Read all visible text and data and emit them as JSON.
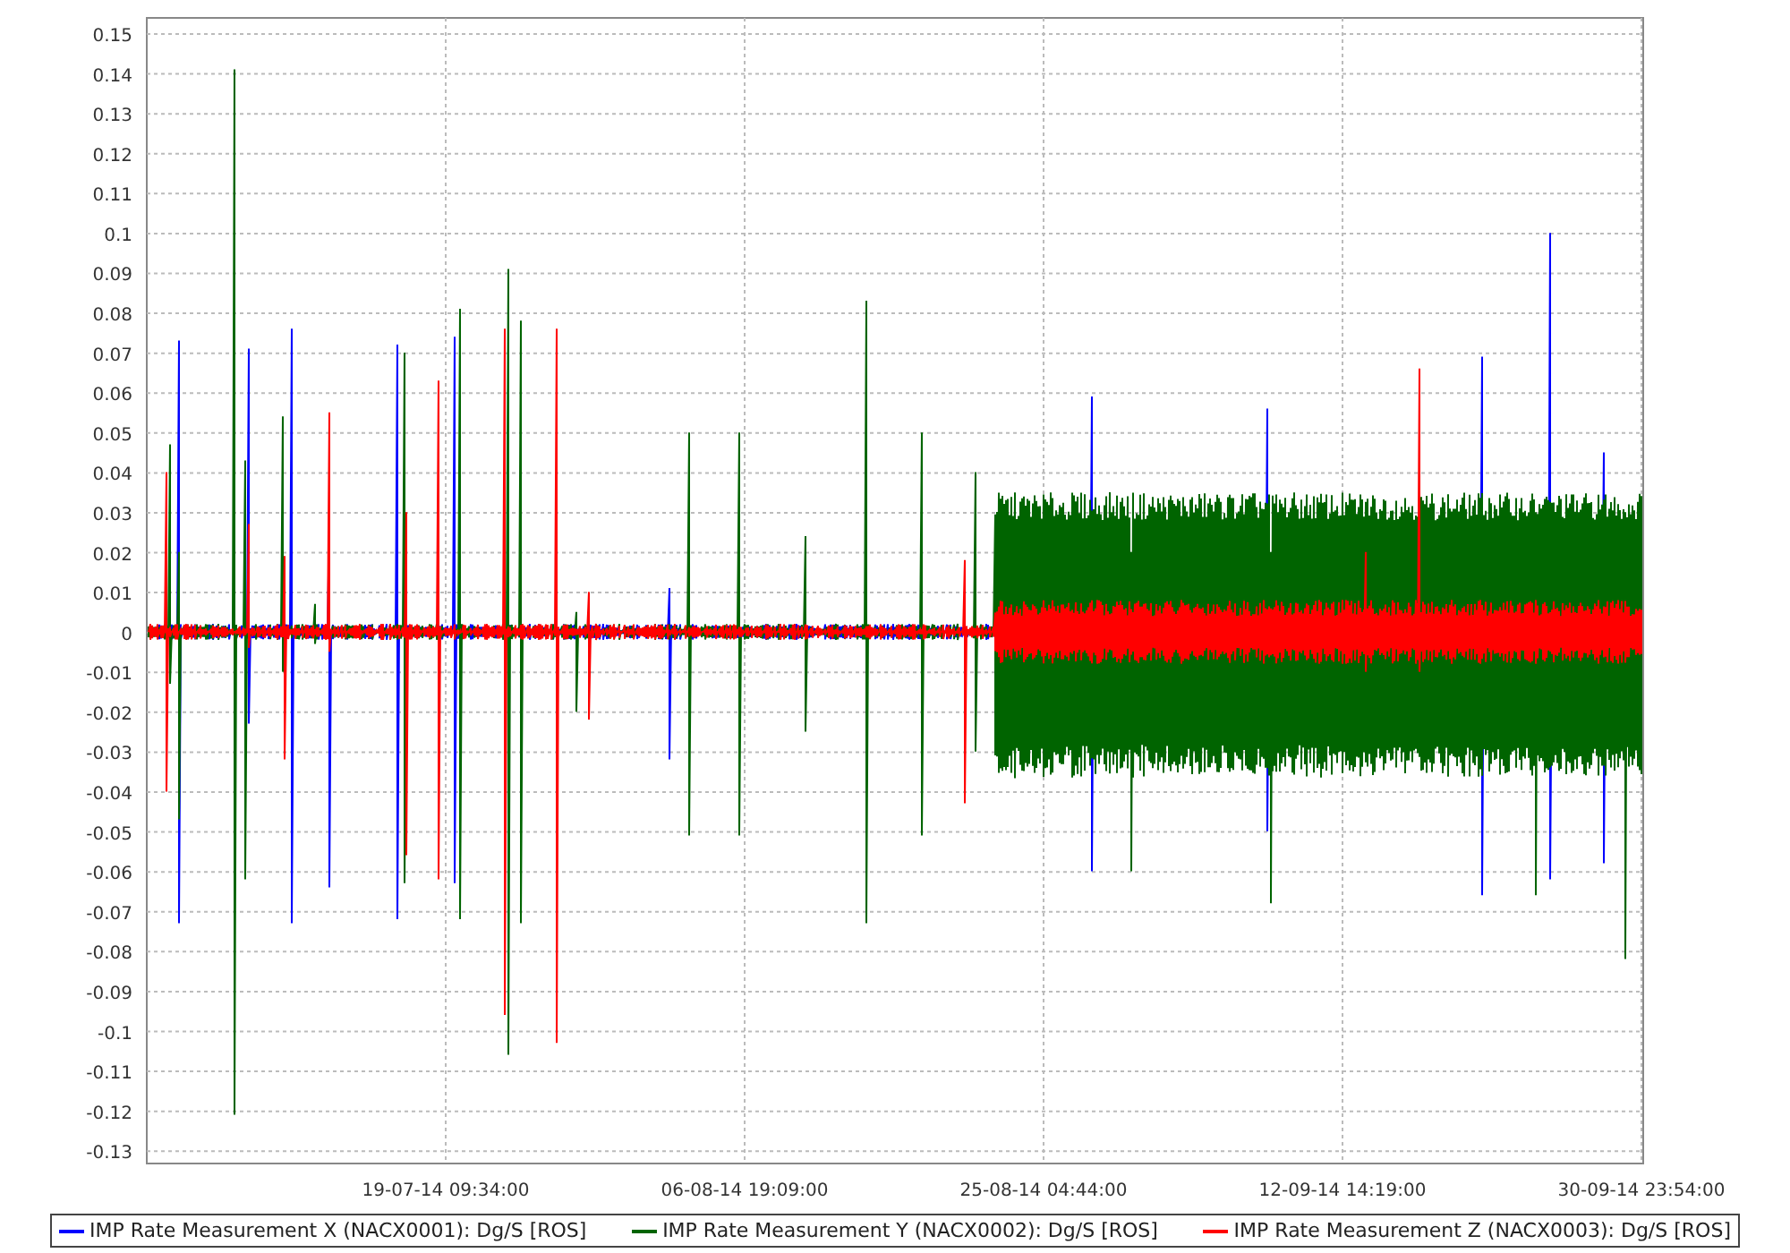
{
  "chart": {
    "y_ticks": [
      "0.15",
      "0.14",
      "0.13",
      "0.12",
      "0.11",
      "0.1",
      "0.09",
      "0.08",
      "0.07",
      "0.06",
      "0.05",
      "0.04",
      "0.03",
      "0.02",
      "0.01",
      "0",
      "-0.01",
      "-0.02",
      "-0.03",
      "-0.04",
      "-0.05",
      "-0.06",
      "-0.07",
      "-0.08",
      "-0.09",
      "-0.1",
      "-0.11",
      "-0.12",
      "-0.13"
    ],
    "x_ticks": [
      "19-07-14 09:34:00",
      "06-08-14 19:09:00",
      "25-08-14 04:44:00",
      "12-09-14 14:19:00",
      "30-09-14 23:54:00"
    ]
  },
  "legend": [
    {
      "name": "IMP Rate Measurement X (NACX0001): Dg/S [ROS]",
      "color": "#0000ff"
    },
    {
      "name": "IMP Rate Measurement Y (NACX0002): Dg/S [ROS]",
      "color": "#006400"
    },
    {
      "name": "IMP Rate Measurement Z (NACX0003): Dg/S [ROS]",
      "color": "#ff0000"
    }
  ]
}
